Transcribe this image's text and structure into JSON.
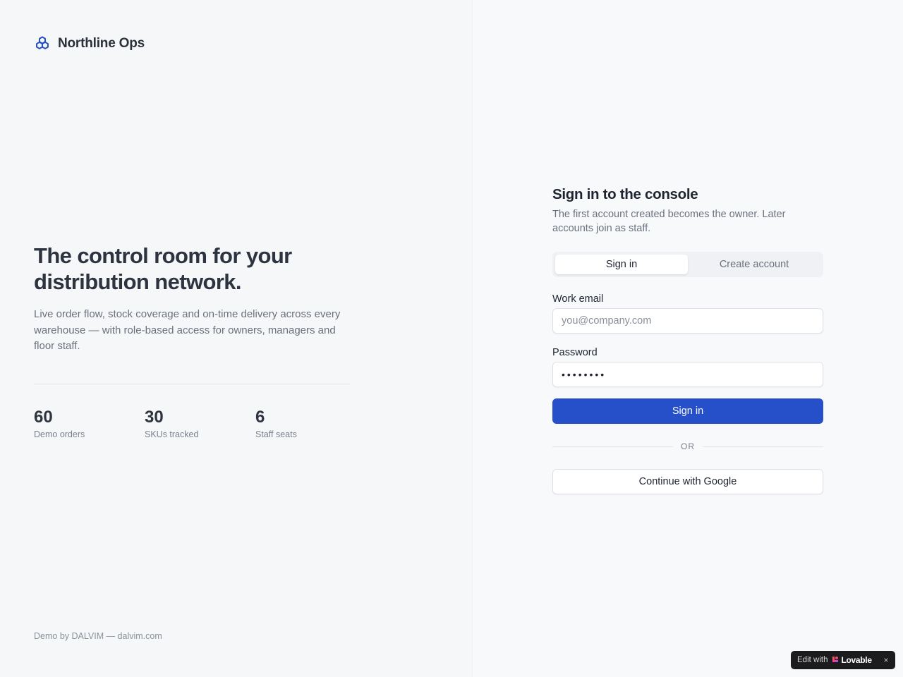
{
  "brand": {
    "name": "Northline Ops",
    "icon": "cubes-icon",
    "accent_color": "#2550c9"
  },
  "hero": {
    "title": "The control room for your distribution network.",
    "description": "Live order flow, stock coverage and on-time delivery across every warehouse — with role-based access for owners, managers and floor staff."
  },
  "stats": [
    {
      "value": "60",
      "label": "Demo orders"
    },
    {
      "value": "30",
      "label": "SKUs tracked"
    },
    {
      "value": "6",
      "label": "Staff seats"
    }
  ],
  "footer": {
    "note": "Demo by DALVIM — dalvim.com"
  },
  "auth": {
    "title": "Sign in to the console",
    "subtitle": "The first account created becomes the owner. Later accounts join as staff.",
    "tabs": [
      {
        "label": "Sign in",
        "active": true
      },
      {
        "label": "Create account",
        "active": false
      }
    ],
    "email": {
      "label": "Work email",
      "placeholder": "you@company.com",
      "value": ""
    },
    "password": {
      "label": "Password",
      "value": "••••••••"
    },
    "submit_label": "Sign in",
    "divider_text": "OR",
    "google_label": "Continue with Google"
  },
  "badge": {
    "prefix": "Edit with",
    "brand": "Lovable",
    "close": "×",
    "icon": "lovable-heart-icon"
  }
}
